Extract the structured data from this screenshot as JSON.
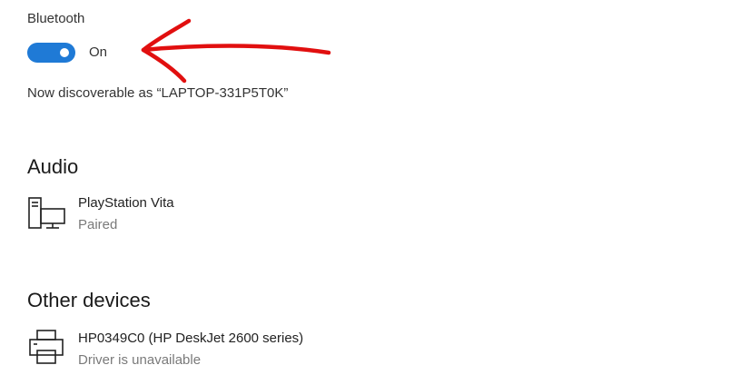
{
  "bluetooth": {
    "label": "Bluetooth",
    "toggle_state": "On",
    "toggle_on": true,
    "accent_color": "#1f7ad6",
    "discoverable_text": "Now discoverable as “LAPTOP-331P5T0K”"
  },
  "sections": {
    "audio": {
      "title": "Audio",
      "devices": [
        {
          "name": "PlayStation Vita",
          "status": "Paired",
          "icon": "computer-monitor-icon"
        }
      ]
    },
    "other": {
      "title": "Other devices",
      "devices": [
        {
          "name": "HP0349C0 (HP DeskJet 2600 series)",
          "status": "Driver is unavailable",
          "icon": "printer-icon"
        }
      ]
    }
  },
  "annotation": {
    "type": "hand-drawn arrow",
    "color": "#e10f0f",
    "points_to": "bluetooth toggle"
  }
}
